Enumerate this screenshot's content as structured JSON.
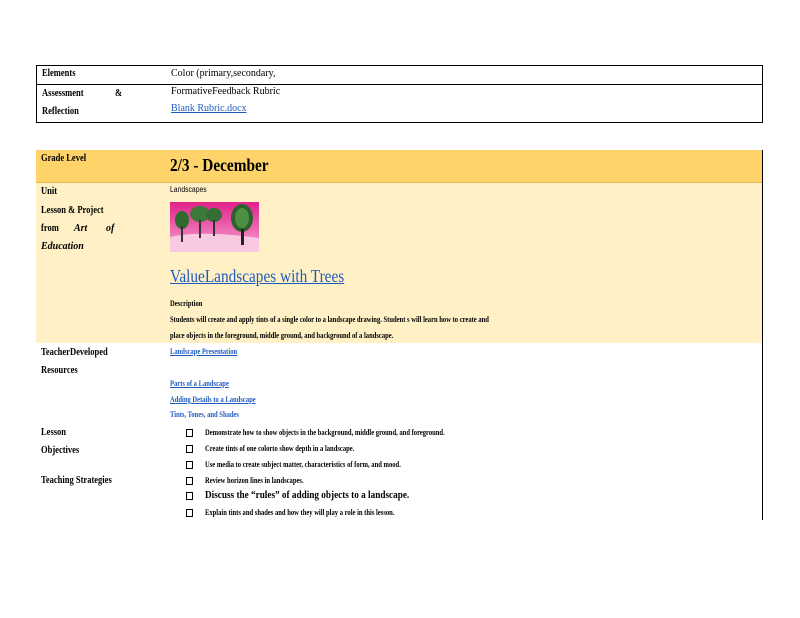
{
  "top_table": {
    "row1_label": "Elements",
    "row1_value": "Color   (primary,secondary,",
    "row2_label_a": "Assessment",
    "row2_label_amp": "&",
    "row2_label_b": "Reflection",
    "row2_value": "FormativeFeedback        Rubric",
    "row2_link": "Blank   Rubric.docx"
  },
  "grade": {
    "label": "Grade     Level",
    "value": "2/3      -  December",
    "unit_label": "Unit",
    "lesson_label": "Lesson       & Project",
    "from_label": "from",
    "art_label": "Art",
    "of_label": "of",
    "education_label": "Education",
    "unit_value": "Landscapes",
    "lesson_title": "ValueLandscapes             with     Trees",
    "description_label": "Description",
    "description_line1": "Students        will    create      and     apply      tints    of     a  single      color      to    a landscape          drawing.          Student      s will    learn      how       to   create       and",
    "description_line2": "place      objects          in    the     foreground,           middle      ground,            and      background            of   a landscape."
  },
  "resources": {
    "label_a": "TeacherDeveloped",
    "label_b": "Resources",
    "link1": "Landscape          Presentation",
    "link2": "Parts      of   a  Landscape",
    "link3": "Adding       Details        to   a  Landscape",
    "link4": "Tints,      Tones,        and     Shades"
  },
  "objectives": {
    "label_a": "Lesson",
    "label_b": "Objectives",
    "items": [
      "Demonstrate                  how        to   show       objects         in   the   background,                    middle       ground,           and     foreground.",
      "Create          tints     of    one    colorto          show       depth       in   a  landscape.",
      "Use      media        to   create        subject        matter,          characteristics                 of  form,       and      mood."
    ]
  },
  "strategies": {
    "label": "Teaching           Strategies",
    "items": [
      "Review         horizon          lines      in   landscapes.",
      "Discuss the “rules” of adding objects to a landscape.",
      "Explain          tints       and      shades          and      how       they       will      play    a  role    in   this    lesson."
    ]
  },
  "colors": {
    "header": "#fdd36a",
    "body": "#fff1c5",
    "link": "#1f5bbf"
  }
}
